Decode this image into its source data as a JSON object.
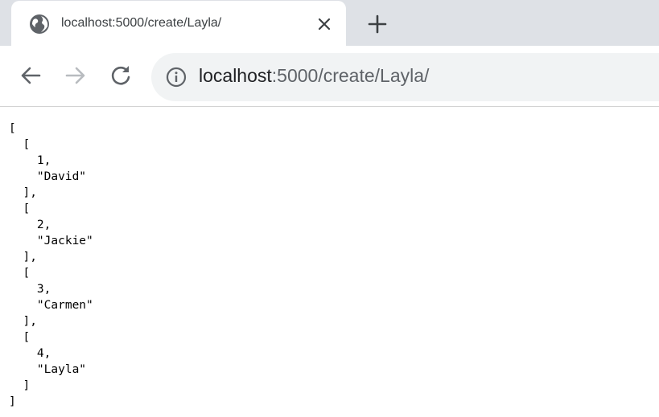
{
  "tab": {
    "title": "localhost:5000/create/Layla/"
  },
  "address_bar": {
    "host": "localhost",
    "path": ":5000/create/Layla/"
  },
  "icons": {
    "favicon": "globe-icon",
    "close": "close-icon",
    "new_tab": "plus-icon",
    "back": "back-arrow-icon",
    "forward": "forward-arrow-icon",
    "reload": "reload-icon",
    "site_info": "info-icon"
  },
  "page": {
    "lines": [
      "[",
      "  [",
      "    1,",
      "    \"David\"",
      "  ],",
      "  [",
      "    2,",
      "    \"Jackie\"",
      "  ],",
      "  [",
      "    3,",
      "    \"Carmen\"",
      "  ],",
      "  [",
      "    4,",
      "    \"Layla\"",
      "  ]",
      "]"
    ]
  }
}
